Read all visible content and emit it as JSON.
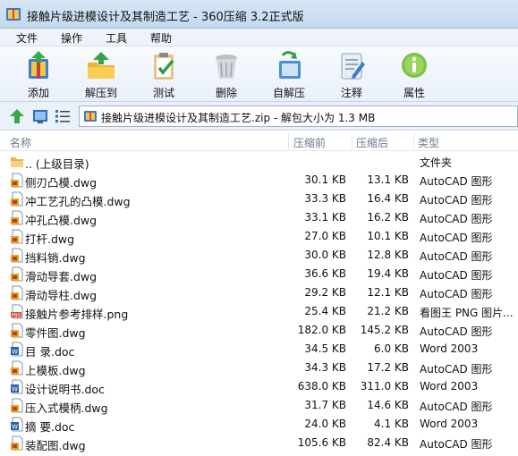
{
  "window": {
    "title": "接触片级进模设计及其制造工艺 - 360压缩 3.2正式版"
  },
  "menu": [
    "文件",
    "操作",
    "工具",
    "帮助"
  ],
  "toolbar": [
    {
      "label": "添加",
      "icon": "add-archive-icon"
    },
    {
      "label": "解压到",
      "icon": "extract-folder-icon"
    },
    {
      "label": "测试",
      "icon": "test-clipboard-icon"
    },
    {
      "label": "删除",
      "icon": "trash-icon"
    },
    {
      "label": "自解压",
      "icon": "self-extract-icon"
    },
    {
      "label": "注释",
      "icon": "comment-icon"
    },
    {
      "label": "属性",
      "icon": "info-icon"
    }
  ],
  "address": {
    "text": "接触片级进模设计及其制造工艺.zip - 解包大小为 1.3 MB"
  },
  "columns": {
    "name": "名称",
    "compressed": "压缩前",
    "packed": "压缩后",
    "type": "类型"
  },
  "files": [
    {
      "name": ".. (上级目录)",
      "compressed": "",
      "packed": "",
      "type": "文件夹",
      "icon": "folder"
    },
    {
      "name": "侧刃凸模.dwg",
      "compressed": "30.1 KB",
      "packed": "13.1 KB",
      "type": "AutoCAD 图形",
      "icon": "dwg"
    },
    {
      "name": "冲工艺孔的凸模.dwg",
      "compressed": "33.3 KB",
      "packed": "16.4 KB",
      "type": "AutoCAD 图形",
      "icon": "dwg"
    },
    {
      "name": "冲孔凸模.dwg",
      "compressed": "33.1 KB",
      "packed": "16.2 KB",
      "type": "AutoCAD 图形",
      "icon": "dwg"
    },
    {
      "name": "打杆.dwg",
      "compressed": "27.0 KB",
      "packed": "10.1 KB",
      "type": "AutoCAD 图形",
      "icon": "dwg"
    },
    {
      "name": "挡料销.dwg",
      "compressed": "30.0 KB",
      "packed": "12.8 KB",
      "type": "AutoCAD 图形",
      "icon": "dwg"
    },
    {
      "name": "滑动导套.dwg",
      "compressed": "36.6 KB",
      "packed": "19.4 KB",
      "type": "AutoCAD 图形",
      "icon": "dwg"
    },
    {
      "name": "滑动导柱.dwg",
      "compressed": "29.2 KB",
      "packed": "12.1 KB",
      "type": "AutoCAD 图形",
      "icon": "dwg"
    },
    {
      "name": "接触片参考排样.png",
      "compressed": "25.4 KB",
      "packed": "21.2 KB",
      "type": "看图王 PNG 图片...",
      "icon": "png"
    },
    {
      "name": "零件图.dwg",
      "compressed": "182.0 KB",
      "packed": "145.2 KB",
      "type": "AutoCAD 图形",
      "icon": "dwg"
    },
    {
      "name": "目 录.doc",
      "compressed": "34.5 KB",
      "packed": "6.0 KB",
      "type": "Word 2003",
      "icon": "doc"
    },
    {
      "name": "上模板.dwg",
      "compressed": "34.3 KB",
      "packed": "17.2 KB",
      "type": "AutoCAD 图形",
      "icon": "dwg"
    },
    {
      "name": "设计说明书.doc",
      "compressed": "638.0 KB",
      "packed": "311.0 KB",
      "type": "Word 2003",
      "icon": "doc"
    },
    {
      "name": "压入式模柄.dwg",
      "compressed": "31.7 KB",
      "packed": "14.6 KB",
      "type": "AutoCAD 图形",
      "icon": "dwg"
    },
    {
      "name": "摘 要.doc",
      "compressed": "24.0 KB",
      "packed": "4.1 KB",
      "type": "Word 2003",
      "icon": "doc"
    },
    {
      "name": "装配图.dwg",
      "compressed": "105.6 KB",
      "packed": "82.4 KB",
      "type": "AutoCAD 图形",
      "icon": "dwg"
    }
  ]
}
